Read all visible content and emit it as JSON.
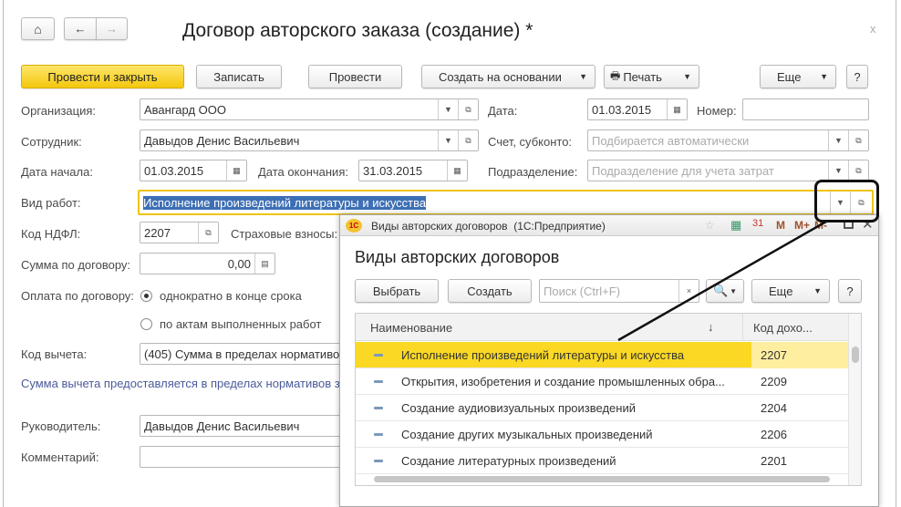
{
  "window": {
    "title": "Договор авторского заказа (создание) *",
    "close": "x"
  },
  "toolbar": {
    "post_close": "Провести и закрыть",
    "save": "Записать",
    "post": "Провести",
    "create_based": "Создать на основании",
    "print": "Печать",
    "more": "Еще",
    "help": "?"
  },
  "form": {
    "org_label": "Организация:",
    "org_value": "Авангард ООО",
    "date_label": "Дата:",
    "date_value": "01.03.2015",
    "number_label": "Номер:",
    "number_value": "",
    "employee_label": "Сотрудник:",
    "employee_value": "Давыдов Денис Васильевич",
    "account_label": "Счет, субконто:",
    "account_placeholder": "Подбирается автоматически",
    "start_label": "Дата начала:",
    "start_value": "01.03.2015",
    "end_label": "Дата окончания:",
    "end_value": "31.03.2015",
    "dept_label": "Подразделение:",
    "dept_placeholder": "Подразделение для учета затрат",
    "work_label": "Вид работ:",
    "work_value": "Исполнение произведений литературы и искусства",
    "ndfl_label": "Код НДФЛ:",
    "ndfl_value": "2207",
    "insurance_label": "Страховые взносы:",
    "sum_label": "Сумма по договору:",
    "sum_value": "0,00",
    "payment_label": "Оплата по договору:",
    "payment_opt1": "однократно в конце срока",
    "payment_opt2": "по актам выполненных работ",
    "payment_selected": 1,
    "deduction_label": "Код вычета:",
    "deduction_value": "(405) Сумма в пределах нормативо",
    "deduction_note": "Сумма вычета предоставляется в пределах нормативов з",
    "head_label": "Руководитель:",
    "head_value": "Давыдов Денис Васильевич",
    "comment_label": "Комментарий:",
    "comment_value": ""
  },
  "dialog": {
    "window_title": "Виды авторских договоров  (1С:Предприятие)",
    "app_logo": "1С",
    "titlebar_icons": [
      "M",
      "M+",
      "M-"
    ],
    "heading": "Виды авторских договоров",
    "select": "Выбрать",
    "create": "Создать",
    "search_placeholder": "Поиск (Ctrl+F)",
    "more": "Еще",
    "help": "?",
    "columns": [
      "Наименование",
      "Код дохо..."
    ],
    "sort_indicator": "↓",
    "rows": [
      {
        "name": "Исполнение произведений литературы и искусства",
        "code": "2207",
        "selected": true
      },
      {
        "name": "Открытия, изобретения и создание промышленных обра...",
        "code": "2209"
      },
      {
        "name": "Создание аудиовизуальных произведений",
        "code": "2204"
      },
      {
        "name": "Создание других музыкальных произведений",
        "code": "2206"
      },
      {
        "name": "Создание литературных произведений",
        "code": "2201"
      }
    ]
  },
  "colors": {
    "accent_yellow": "#f5c913",
    "selected_row": "#fbd824",
    "selection_text_bg": "#3d6fb4",
    "link_text": "#4b5a9a"
  }
}
